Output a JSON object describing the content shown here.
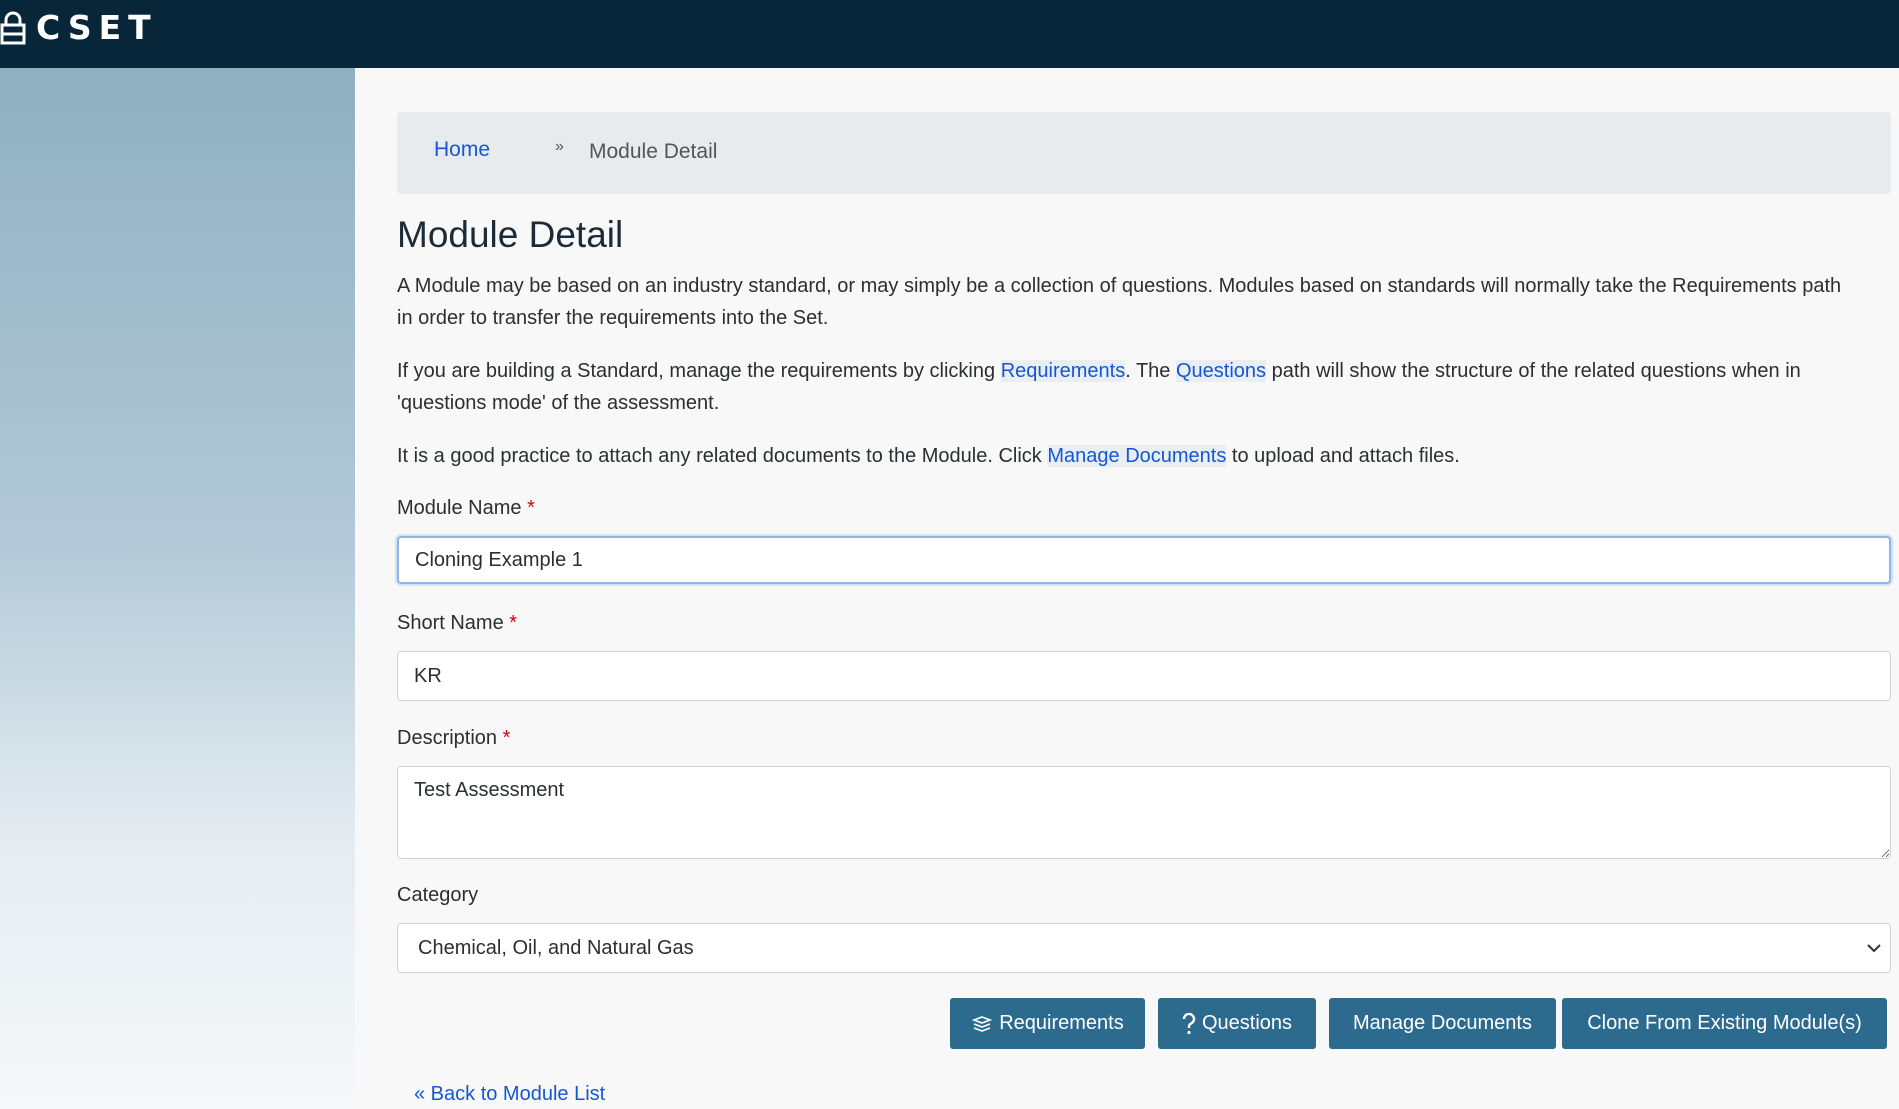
{
  "app": {
    "logo_text": "CSET",
    "colors": {
      "header_bg": "#08263a",
      "link": "#1457d6",
      "button_bg": "#2d6b8e",
      "required_marker": "#d0021b"
    }
  },
  "breadcrumb": {
    "home": "Home",
    "separator": "»",
    "current": "Module Detail"
  },
  "page": {
    "title": "Module Detail",
    "intro": "A Module may be based on an industry standard, or may simply be a collection of questions. Modules based on standards will normally take the Requirements path in order to transfer the requirements into the Set.",
    "p2": {
      "before": "If you are building a Standard, manage the requirements by clicking ",
      "link1": "Requirements",
      "middle": ". The ",
      "link2": "Questions",
      "after": " path will show the structure of the related questions when in 'questions mode' of the assessment."
    },
    "p3": {
      "before": "It is a good practice to attach any related documents to the Module. Click ",
      "link": "Manage Documents",
      "after": " to upload and attach files."
    }
  },
  "form": {
    "required_marker": "*",
    "module_name": {
      "label": "Module Name",
      "value": "Cloning Example 1"
    },
    "short_name": {
      "label": "Short Name",
      "value": "KR"
    },
    "description": {
      "label": "Description",
      "value": "Test Assessment"
    },
    "category": {
      "label": "Category",
      "selected": "Chemical, Oil, and Natural Gas"
    }
  },
  "buttons": {
    "requirements": {
      "label": "Requirements",
      "icon": "stack-icon"
    },
    "questions": {
      "label": "Questions",
      "icon": "question-mark-icon"
    },
    "manage_documents": {
      "label": "Manage Documents"
    },
    "clone": {
      "label": "Clone From Existing Module(s)"
    }
  },
  "back_link": "« Back to Module List"
}
